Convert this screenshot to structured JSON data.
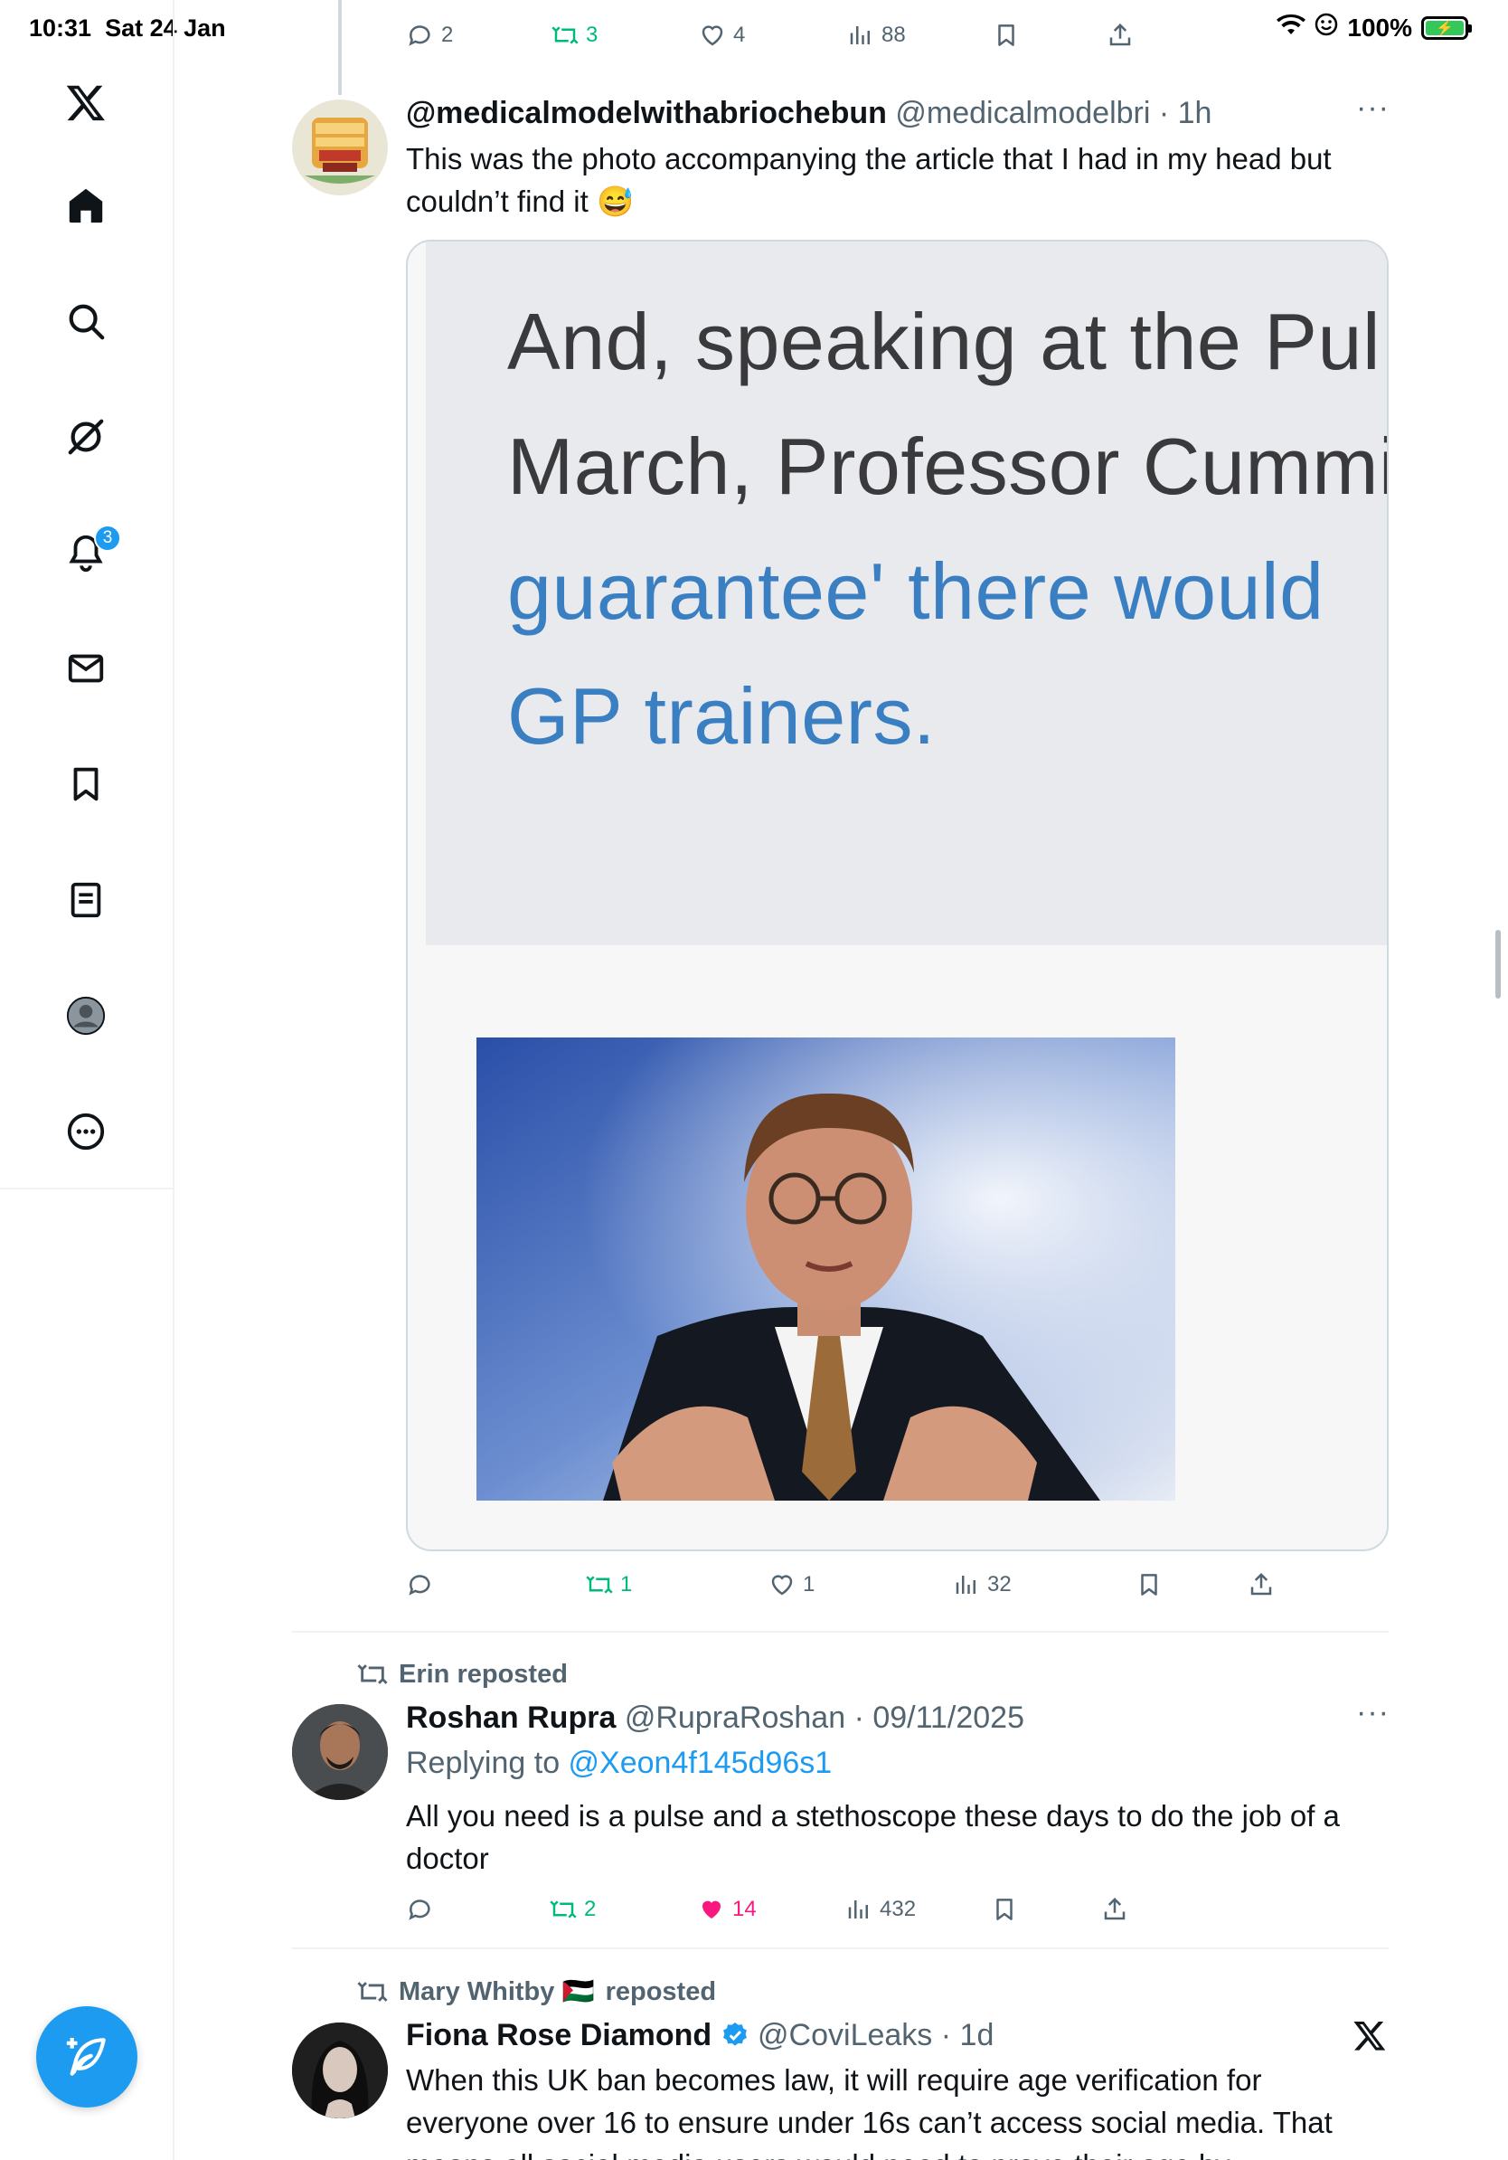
{
  "status_bar": {
    "time": "10:31",
    "date": "Sat 24 Jan",
    "battery": "100%"
  },
  "sidebar": {
    "notification_count": "3",
    "items": [
      "x-logo-icon",
      "home-icon",
      "search-icon",
      "grok-icon",
      "notifications-icon",
      "messages-icon",
      "bookmarks-icon",
      "lists-icon",
      "profile-icon",
      "more-icon"
    ],
    "compose_icon": "compose-post-icon"
  },
  "prev_tweet_actions": {
    "replies": "2",
    "reposts": "3",
    "likes": "4",
    "views": "88"
  },
  "tweet1": {
    "name": "@medicalmodelwithabriochebun",
    "handle": "@medicalmodelbri",
    "time": "1h",
    "text": "This was the photo accompanying the article that I had in my head but couldn’t find it 😅",
    "media": {
      "line1": "And, speaking at the Pul",
      "line2": "March, Professor Cummi",
      "line3": "guarantee' there would",
      "line4": "GP trainers."
    },
    "actions": {
      "replies": "",
      "reposts": "1",
      "likes": "1",
      "views": "32"
    }
  },
  "tweet2": {
    "reposted_by": "Erin reposted",
    "name": "Roshan Rupra",
    "handle": "@RupraRoshan",
    "time": "09/11/2025",
    "replying_prefix": "Replying to ",
    "replying_to": "@Xeon4f145d96s1",
    "text": "All you need is a pulse and a stethoscope these days to do the job of a doctor",
    "actions": {
      "replies": "",
      "reposts": "2",
      "likes": "14",
      "views": "432"
    }
  },
  "tweet3": {
    "reposted_by_name": "Mary Whitby 🇵🇸",
    "reposted_suffix": "reposted",
    "name": "Fiona Rose Diamond",
    "handle": "@CoviLeaks",
    "time": "1d",
    "text": "When this UK ban becomes law, it will require age verification for everyone over 16 to ensure under 16s can’t access social media. That means all social media users would need to prove their age by"
  },
  "colors": {
    "accent": "#1d9bf0",
    "repost_green": "#00ba7c",
    "like_pink": "#f91880",
    "secondary_text": "#536471"
  }
}
